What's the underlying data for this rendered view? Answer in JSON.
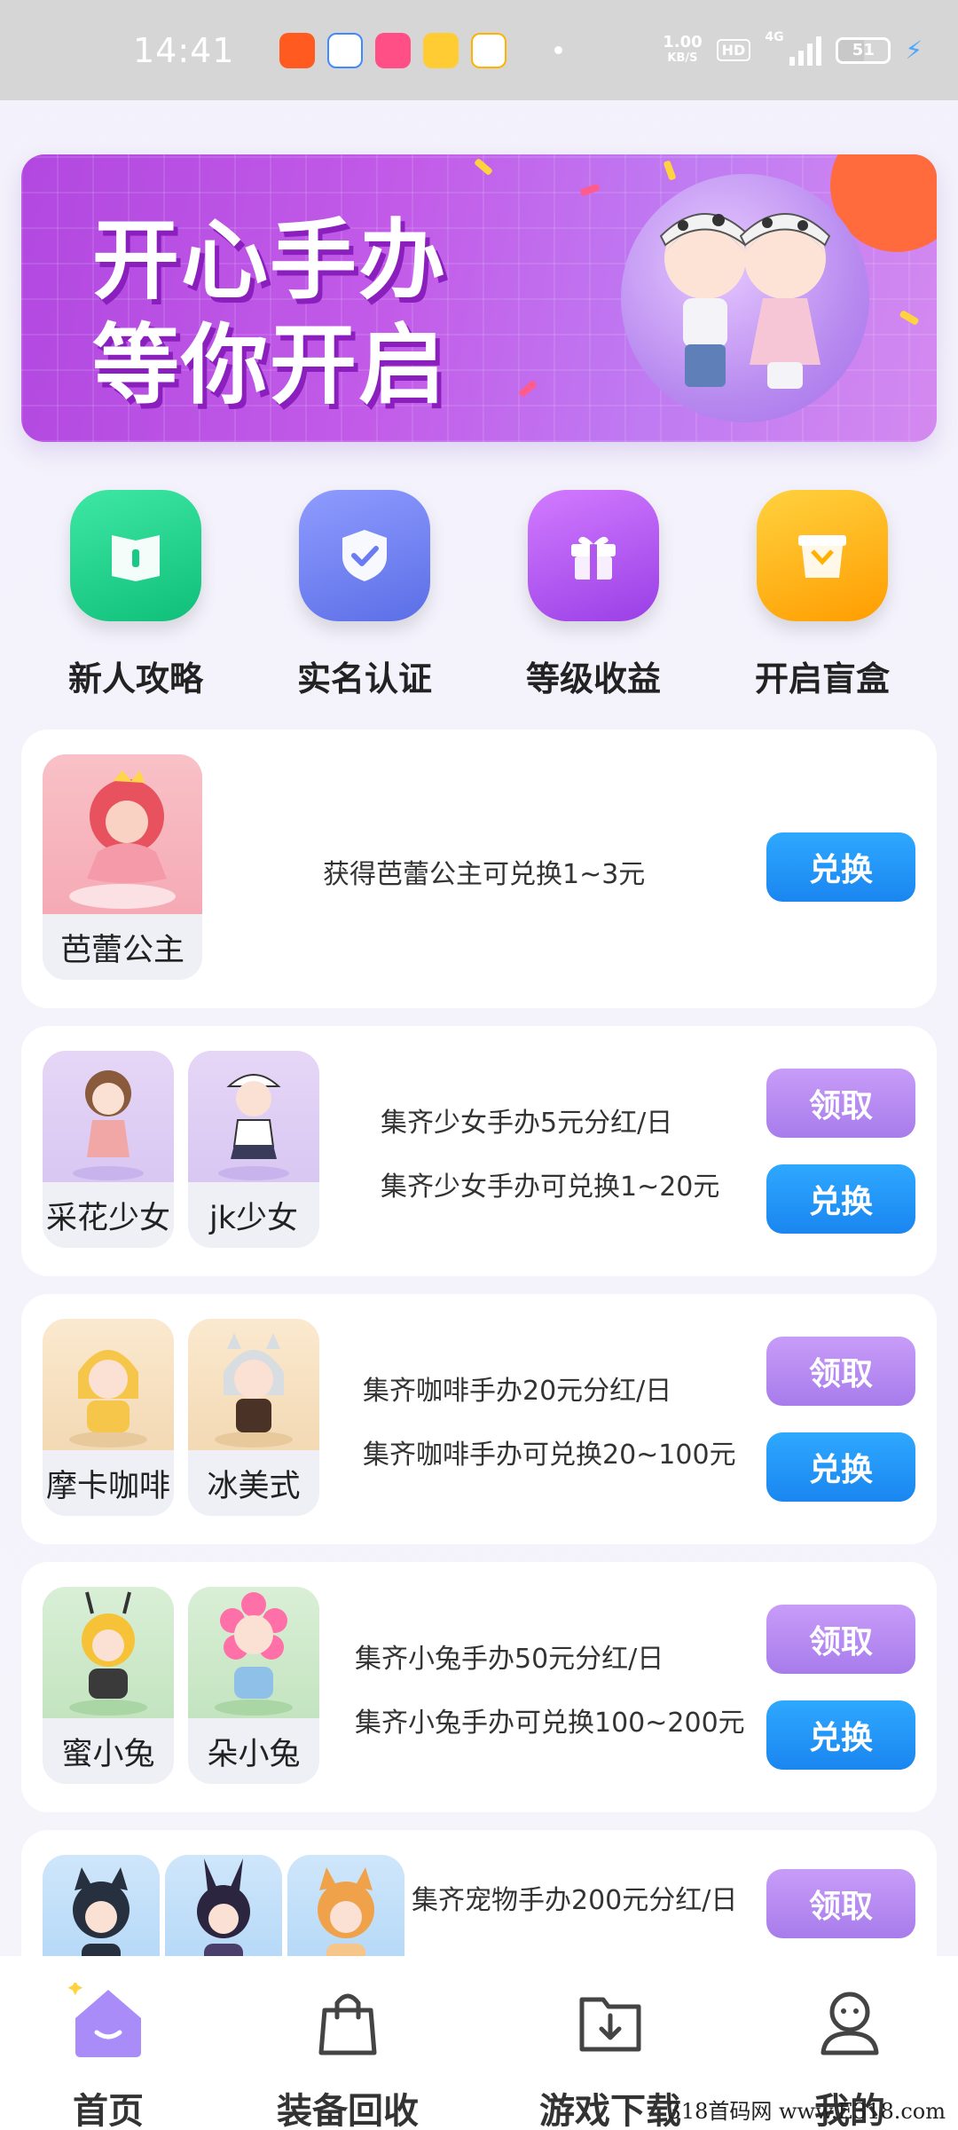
{
  "status_bar": {
    "time": "14:41",
    "net_speed_value": "1.00",
    "net_speed_unit": "KB/S",
    "hd": "HD",
    "network": "4G",
    "battery": "51",
    "battery_level_percent": 51
  },
  "banner": {
    "line1": "开心手办",
    "line2": "等你开启"
  },
  "quick_actions": [
    {
      "label": "新人攻略",
      "icon": "book-icon",
      "color": "#1ed28c"
    },
    {
      "label": "实名认证",
      "icon": "shield-check-icon",
      "color": "#6b7cf2"
    },
    {
      "label": "等级收益",
      "icon": "gift-icon",
      "color": "#b157ef"
    },
    {
      "label": "开启盲盒",
      "icon": "blind-box-icon",
      "color": "#ffb000"
    }
  ],
  "cards": [
    {
      "figures": [
        "芭蕾公主"
      ],
      "line1": "获得芭蕾公主可兑换1~3元",
      "exchange": "兑换"
    },
    {
      "figures": [
        "采花少女",
        "jk少女"
      ],
      "line1": "集齐少女手办5元分红/日",
      "line2": "集齐少女手办可兑换1~20元",
      "claim": "领取",
      "exchange": "兑换"
    },
    {
      "figures": [
        "摩卡咖啡",
        "冰美式"
      ],
      "line1": "集齐咖啡手办20元分红/日",
      "line2": "集齐咖啡手办可兑换20~100元",
      "claim": "领取",
      "exchange": "兑换"
    },
    {
      "figures": [
        "蜜小兔",
        "朵小兔"
      ],
      "line1": "集齐小兔手办50元分红/日",
      "line2": "集齐小兔手办可兑换100~200元",
      "claim": "领取",
      "exchange": "兑换"
    },
    {
      "line1": "集齐宠物手办200元分红/日",
      "claim": "领取"
    }
  ],
  "bottom_nav": [
    {
      "label": "首页",
      "icon": "home-icon",
      "active": true
    },
    {
      "label": "装备回收",
      "icon": "shopping-bag-icon"
    },
    {
      "label": "游戏下载",
      "icon": "download-folder-icon"
    },
    {
      "label": "我的",
      "icon": "user-icon"
    }
  ],
  "watermark": "318首码网 www.E318.com",
  "colors": {
    "accent_blue": "#1a86f0",
    "accent_purple": "#a77ceb",
    "banner_purple": "#c25be8"
  }
}
